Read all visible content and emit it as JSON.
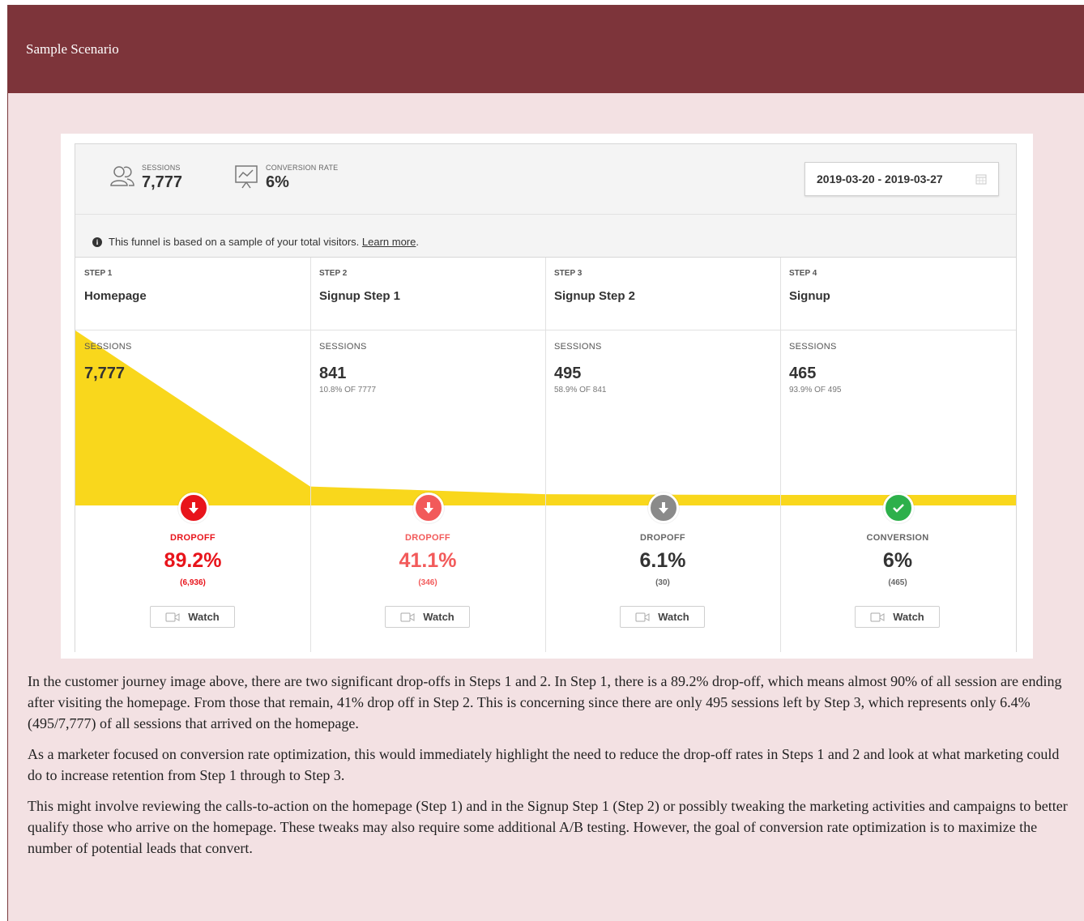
{
  "banner": {
    "title": "Sample Scenario"
  },
  "summary": {
    "sessions_label": "SESSIONS",
    "sessions_value": "7,777",
    "conversion_label": "CONVERSION RATE",
    "conversion_value": "6%",
    "date_range": "2019-03-20 - 2019-03-27"
  },
  "notice": {
    "text": "This funnel is based on a sample of your total visitors.",
    "link": "Learn more",
    "tail": "."
  },
  "funnel": {
    "sessions_label": "SESSIONS",
    "steps": [
      {
        "step": "STEP 1",
        "name": "Homepage",
        "sessions": "7,777",
        "pct": "",
        "fill_fraction": 1.0,
        "outcome_label": "DROPOFF",
        "outcome_pct": "89.2%",
        "outcome_count": "(6,936)",
        "outcome_color": "#e8141b",
        "watch": "Watch"
      },
      {
        "step": "STEP 2",
        "name": "Signup Step 1",
        "sessions": "841",
        "pct": "10.8% OF 7777",
        "fill_fraction": 0.108,
        "outcome_label": "DROPOFF",
        "outcome_pct": "41.1%",
        "outcome_count": "(346)",
        "outcome_color": "#f25a5a",
        "watch": "Watch"
      },
      {
        "step": "STEP 3",
        "name": "Signup Step 2",
        "sessions": "495",
        "pct": "58.9% OF 841",
        "fill_fraction": 0.064,
        "outcome_label": "DROPOFF",
        "outcome_pct": "6.1%",
        "outcome_count": "(30)",
        "outcome_color": "#8a8a8a",
        "watch": "Watch"
      },
      {
        "step": "STEP 4",
        "name": "Signup",
        "sessions": "465",
        "pct": "93.9% OF 495",
        "fill_fraction": 0.06,
        "outcome_label": "CONVERSION",
        "outcome_pct": "6%",
        "outcome_count": "(465)",
        "outcome_color": "#2db04b",
        "watch": "Watch"
      }
    ],
    "colors": {
      "fill": "#f9d71c",
      "text_dark": "#333333",
      "muted": "#777777"
    }
  },
  "article": {
    "paragraphs": [
      "In the customer journey image above, there are two significant drop-offs in Steps 1 and 2. In Step 1, there is a 89.2% drop-off, which means almost 90% of all session are ending after visiting the homepage. From those that remain, 41% drop off in Step 2. This is concerning since there are only 495 sessions left by Step 3, which represents only 6.4% (495/7,777) of all sessions that arrived on the homepage.",
      "As a marketer focused on conversion rate optimization, this would immediately highlight the need to reduce the drop-off rates in Steps 1 and 2 and look at what marketing could do to increase retention from Step 1 through to Step 3.",
      "This might involve reviewing the calls-to-action on the homepage (Step 1) and in the Signup Step 1 (Step 2) or possibly tweaking the marketing activities and campaigns to better qualify those who arrive on the homepage. These tweaks may also require some additional A/B testing. However, the goal of conversion rate optimization is to maximize the number of potential leads that convert."
    ]
  }
}
